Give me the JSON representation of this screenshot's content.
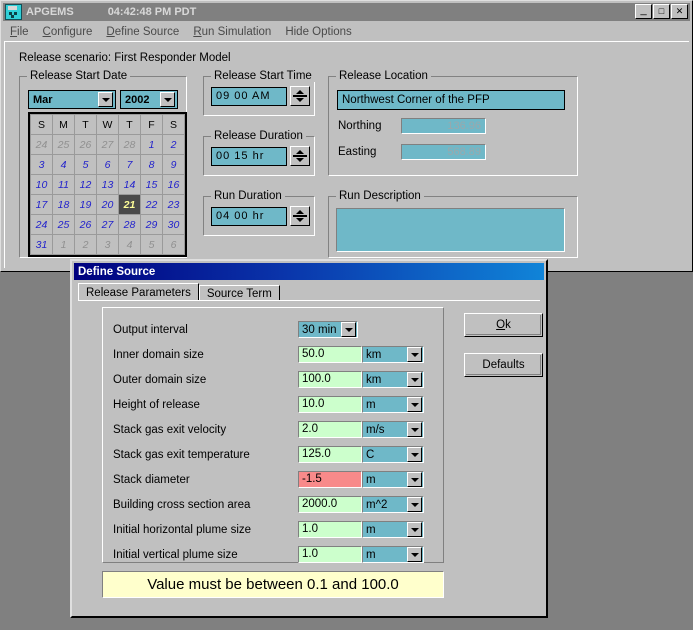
{
  "app": {
    "title": "APGEMS",
    "clock": "04:42:48 PM PDT",
    "icon": "apgems-app-icon",
    "window_buttons": {
      "minimize": "_",
      "maximize": "□",
      "close": "✕"
    },
    "menu": [
      {
        "label": "File",
        "mnemonic": "F"
      },
      {
        "label": "Configure",
        "mnemonic": "C"
      },
      {
        "label": "Define Source",
        "mnemonic": "D"
      },
      {
        "label": "Run Simulation",
        "mnemonic": "R"
      },
      {
        "label": "Hide Options",
        "mnemonic": ""
      }
    ],
    "scenario_label": "Release scenario: First Responder Model"
  },
  "release_start_date": {
    "group_title": "Release Start Date",
    "month": "Mar",
    "year": "2002",
    "dow": [
      "S",
      "M",
      "T",
      "W",
      "T",
      "F",
      "S"
    ],
    "weeks": [
      [
        {
          "d": "24",
          "o": true
        },
        {
          "d": "25",
          "o": true
        },
        {
          "d": "26",
          "o": true
        },
        {
          "d": "27",
          "o": true
        },
        {
          "d": "28",
          "o": true
        },
        {
          "d": "1",
          "o": false
        },
        {
          "d": "2",
          "o": false
        }
      ],
      [
        {
          "d": "3",
          "o": false
        },
        {
          "d": "4",
          "o": false
        },
        {
          "d": "5",
          "o": false
        },
        {
          "d": "6",
          "o": false
        },
        {
          "d": "7",
          "o": false
        },
        {
          "d": "8",
          "o": false
        },
        {
          "d": "9",
          "o": false
        }
      ],
      [
        {
          "d": "10",
          "o": false
        },
        {
          "d": "11",
          "o": false
        },
        {
          "d": "12",
          "o": false
        },
        {
          "d": "13",
          "o": false
        },
        {
          "d": "14",
          "o": false
        },
        {
          "d": "15",
          "o": false
        },
        {
          "d": "16",
          "o": false
        }
      ],
      [
        {
          "d": "17",
          "o": false
        },
        {
          "d": "18",
          "o": false
        },
        {
          "d": "19",
          "o": false
        },
        {
          "d": "20",
          "o": false
        },
        {
          "d": "21",
          "o": false,
          "sel": true
        },
        {
          "d": "22",
          "o": false
        },
        {
          "d": "23",
          "o": false
        }
      ],
      [
        {
          "d": "24",
          "o": false
        },
        {
          "d": "25",
          "o": false
        },
        {
          "d": "26",
          "o": false
        },
        {
          "d": "27",
          "o": false
        },
        {
          "d": "28",
          "o": false
        },
        {
          "d": "29",
          "o": false
        },
        {
          "d": "30",
          "o": false
        }
      ],
      [
        {
          "d": "31",
          "o": false
        },
        {
          "d": "1",
          "o": true
        },
        {
          "d": "2",
          "o": true
        },
        {
          "d": "3",
          "o": true
        },
        {
          "d": "4",
          "o": true
        },
        {
          "d": "5",
          "o": true
        },
        {
          "d": "6",
          "o": true
        }
      ]
    ],
    "selected_day": "21"
  },
  "release_start_time": {
    "group_title": "Release Start Time",
    "value": "09  00 AM"
  },
  "release_duration": {
    "group_title": "Release Duration",
    "value": "00  15 hr"
  },
  "run_duration": {
    "group_title": "Run Duration",
    "value": "04  00 hr"
  },
  "release_location": {
    "group_title": "Release Location",
    "location": "Northwest Corner of the PFP",
    "northing_label": "Northing",
    "northing_value": "136.96",
    "easting_label": "Easting",
    "easting_value": "568.89"
  },
  "run_description": {
    "group_title": "Run Description",
    "value": ""
  },
  "dialog": {
    "title": "Define Source",
    "tabs": [
      {
        "label": "Release Parameters",
        "active": true
      },
      {
        "label": "Source Term",
        "active": false
      }
    ],
    "buttons": {
      "ok": "Ok",
      "ok_mnemonic": "O",
      "defaults": "Defaults"
    },
    "params": [
      {
        "label": "Output interval",
        "value": "30 min",
        "kind": "combo"
      },
      {
        "label": "Inner domain size",
        "value": "50.0",
        "unit": "km",
        "invalid": false
      },
      {
        "label": "Outer domain size",
        "value": "100.0",
        "unit": "km",
        "invalid": false
      },
      {
        "label": "Height of release",
        "value": "10.0",
        "unit": "m",
        "invalid": false
      },
      {
        "label": "Stack gas exit velocity",
        "value": "2.0",
        "unit": "m/s",
        "invalid": false
      },
      {
        "label": "Stack gas exit temperature",
        "value": "125.0",
        "unit": "C",
        "invalid": false
      },
      {
        "label": "Stack diameter",
        "value": "-1.5",
        "unit": "m",
        "invalid": true
      },
      {
        "label": "Building cross section area",
        "value": "2000.0",
        "unit": "m^2",
        "invalid": false
      },
      {
        "label": "Initial horizontal plume size",
        "value": "1.0",
        "unit": "m",
        "invalid": false
      },
      {
        "label": "Initial vertical plume size",
        "value": "1.0",
        "unit": "m",
        "invalid": false
      }
    ],
    "status_message": "Value must be between 0.1 and 100.0"
  },
  "colors": {
    "desktop": "#808080",
    "face": "#c0c0c0",
    "field_teal": "#6fb8c8",
    "field_valid": "#ccffcc",
    "field_invalid": "#f88a8a",
    "status_bg": "#ffffcc",
    "title_active_start": "#00007e",
    "title_active_end": "#1084d8",
    "calendar_day": "#2222cc",
    "calendar_selected_bg": "#4a4a4a",
    "calendar_selected_fg": "#ffff99"
  }
}
